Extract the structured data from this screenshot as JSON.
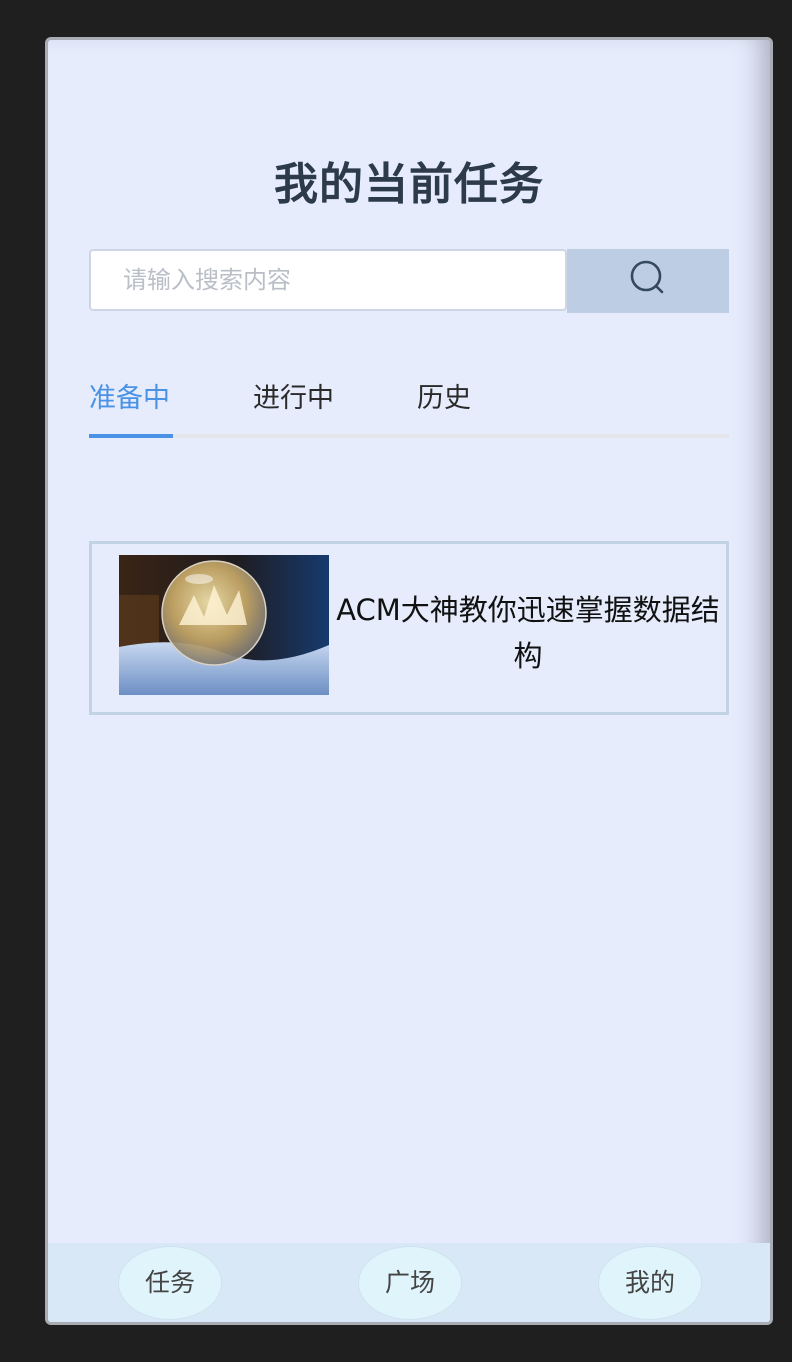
{
  "header": {
    "title": "我的当前任务"
  },
  "search": {
    "placeholder": "请输入搜索内容",
    "value": "",
    "button_icon": "search-icon"
  },
  "tabs": [
    {
      "label": "准备中",
      "active": true
    },
    {
      "label": "进行中",
      "active": false
    },
    {
      "label": "历史",
      "active": false
    }
  ],
  "tasks": [
    {
      "title": "ACM大神教你迅速掌握数据结构",
      "thumbnail": "frozen-bubble-image"
    }
  ],
  "bottom_nav": [
    {
      "label": "任务"
    },
    {
      "label": "广场"
    },
    {
      "label": "我的"
    }
  ],
  "colors": {
    "accent": "#4a92e6",
    "background": "#e6ecfc",
    "search_button": "#bccde4",
    "title": "#2c3a4a"
  }
}
